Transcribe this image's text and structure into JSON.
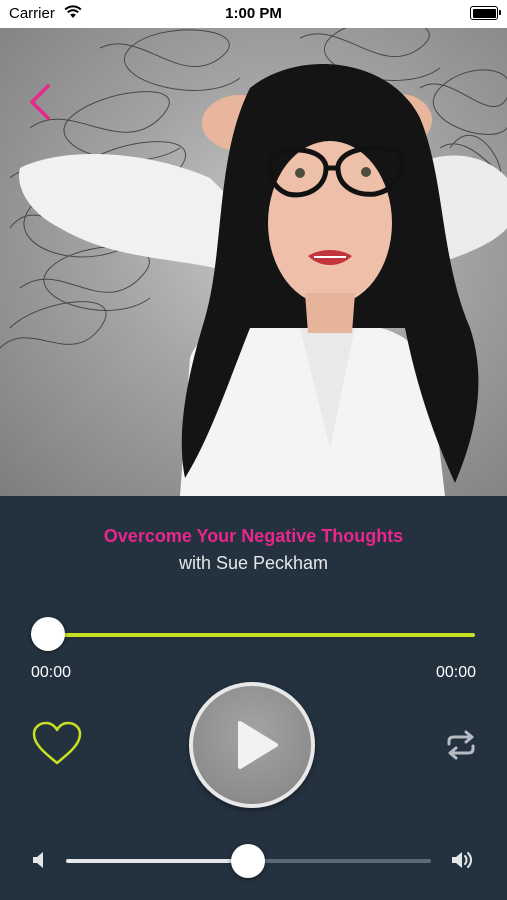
{
  "status_bar": {
    "carrier": "Carrier",
    "time": "1:00 PM",
    "icons": [
      "wifi-icon",
      "battery-icon"
    ]
  },
  "hero": {
    "image": "woman-with-glasses-stressed-photo",
    "back_icon": "chevron-left-icon"
  },
  "player": {
    "title": "Overcome Your Negative Thoughts",
    "subtitle": "with Sue Peckham",
    "elapsed": "00:00",
    "total": "00:00",
    "progress": 0,
    "volume": 0.5,
    "icons": {
      "favorite": "heart-icon",
      "play": "play-icon",
      "repeat": "repeat-icon",
      "volume_low": "volume-low-icon",
      "volume_high": "volume-high-icon"
    }
  },
  "colors": {
    "accent_pink": "#e9268c",
    "accent_lime": "#c7e122",
    "background": "#243240"
  }
}
